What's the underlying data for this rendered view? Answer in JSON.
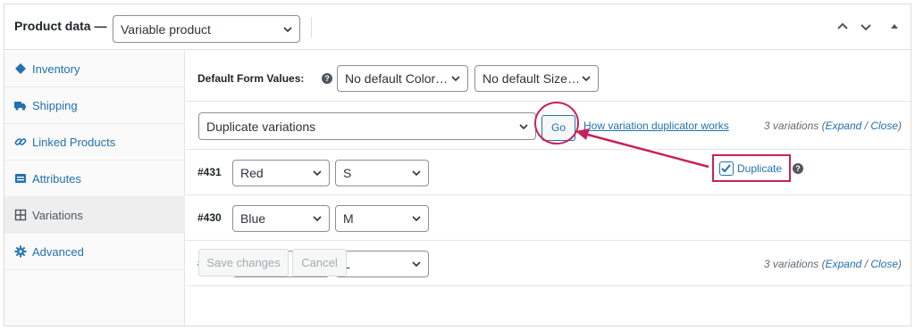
{
  "header": {
    "title": "Product data —",
    "product_type": "Variable product"
  },
  "sidebar": {
    "items": [
      {
        "label": "Inventory",
        "icon": "diamond-tag-icon",
        "active": false
      },
      {
        "label": "Shipping",
        "icon": "truck-icon",
        "active": false
      },
      {
        "label": "Linked Products",
        "icon": "link-icon",
        "active": false
      },
      {
        "label": "Attributes",
        "icon": "list-card-icon",
        "active": false
      },
      {
        "label": "Variations",
        "icon": "grid-icon",
        "active": true
      },
      {
        "label": "Advanced",
        "icon": "gear-icon",
        "active": false
      }
    ]
  },
  "defaults": {
    "label": "Default Form Values:",
    "help": "?",
    "color_select": "No default Color…",
    "size_select": "No default Size…"
  },
  "bulk": {
    "action": "Duplicate variations",
    "go_label": "Go",
    "help_link": "How variation duplicator works",
    "count_text": "3 variations (",
    "expand": "Expand",
    "sep": " / ",
    "close": "Close",
    "close_paren": ")"
  },
  "variations": [
    {
      "id": "#431",
      "color": "Red",
      "size": "S"
    },
    {
      "id": "#430",
      "color": "Blue",
      "size": "M"
    },
    {
      "id": "#429",
      "color": "Green",
      "size": "L"
    }
  ],
  "duplicate": {
    "label": "Duplicate",
    "checked": true,
    "help": "?"
  },
  "footer": {
    "save_label": "Save changes",
    "cancel_label": "Cancel",
    "count_text": "3 variations (",
    "expand": "Expand",
    "sep": " / ",
    "close": "Close",
    "close_paren": ")"
  },
  "colors": {
    "accent": "#2271b1",
    "highlight": "#c8205a"
  }
}
